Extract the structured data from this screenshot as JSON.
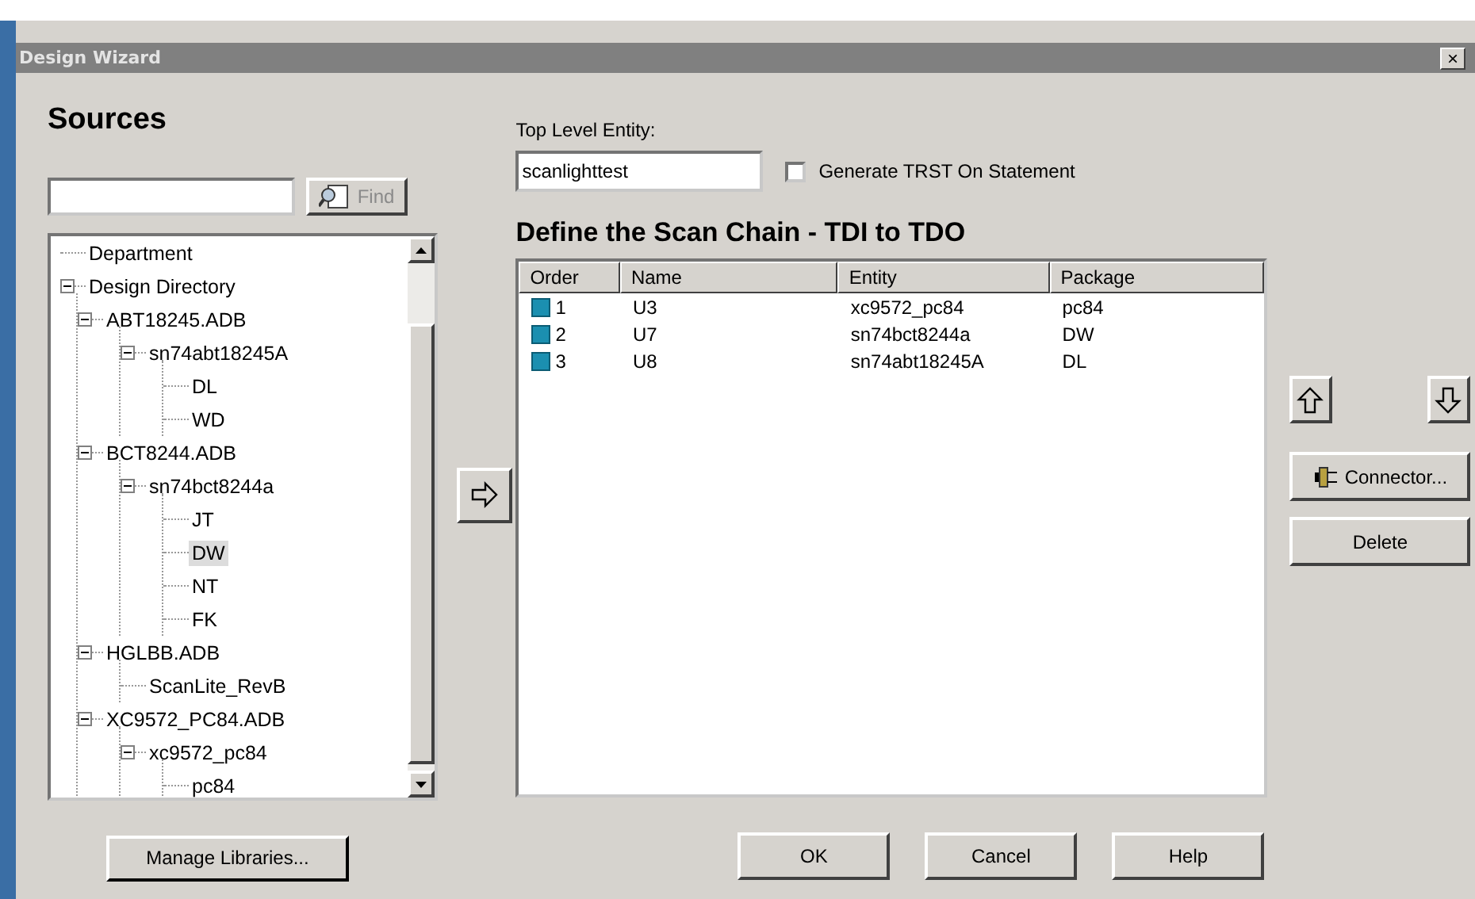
{
  "window": {
    "title": "Design Wizard",
    "close": "×"
  },
  "sources": {
    "heading": "Sources",
    "find_button": "Find",
    "tree": [
      {
        "label": "Department",
        "selected": false
      },
      {
        "label": "Design Directory",
        "selected": false,
        "expanded": true,
        "children": [
          {
            "label": "ABT18245.ADB",
            "selected": false,
            "expanded": true,
            "children": [
              {
                "label": "sn74abt18245A",
                "selected": false,
                "expanded": true,
                "children": [
                  {
                    "label": "DL",
                    "selected": false
                  },
                  {
                    "label": "WD",
                    "selected": false
                  }
                ]
              }
            ]
          },
          {
            "label": "BCT8244.ADB",
            "selected": false,
            "expanded": true,
            "children": [
              {
                "label": "sn74bct8244a",
                "selected": false,
                "expanded": true,
                "children": [
                  {
                    "label": "JT",
                    "selected": false
                  },
                  {
                    "label": "DW",
                    "selected": true
                  },
                  {
                    "label": "NT",
                    "selected": false
                  },
                  {
                    "label": "FK",
                    "selected": false
                  }
                ]
              }
            ]
          },
          {
            "label": "HGLBB.ADB",
            "selected": false,
            "expanded": true,
            "children": [
              {
                "label": "ScanLite_RevB",
                "selected": false
              }
            ]
          },
          {
            "label": "XC9572_PC84.ADB",
            "selected": false,
            "expanded": true,
            "children": [
              {
                "label": "xc9572_pc84",
                "selected": false,
                "expanded": true,
                "children": [
                  {
                    "label": "pc84",
                    "selected": false
                  }
                ]
              }
            ]
          }
        ]
      }
    ],
    "manage_button": "Manage Libraries..."
  },
  "top_level_entity": {
    "label": "Top Level Entity:",
    "value": "scanlighttest"
  },
  "generate_trst": {
    "label": "Generate TRST On Statement",
    "checked": false
  },
  "scan_chain": {
    "heading": "Define the Scan Chain - TDI to TDO",
    "columns": [
      "Order",
      "Name",
      "Entity",
      "Package"
    ],
    "rows": [
      {
        "order": "1",
        "name": "U3",
        "entity": "xc9572_pc84",
        "package": "pc84"
      },
      {
        "order": "2",
        "name": "U7",
        "entity": "sn74bct8244a",
        "package": "DW"
      },
      {
        "order": "3",
        "name": "U8",
        "entity": "sn74abt18245A",
        "package": "DL"
      }
    ]
  },
  "side_buttons": {
    "connector": "Connector...",
    "delete": "Delete"
  },
  "buttons": [
    "OK",
    "Cancel",
    "Help"
  ]
}
